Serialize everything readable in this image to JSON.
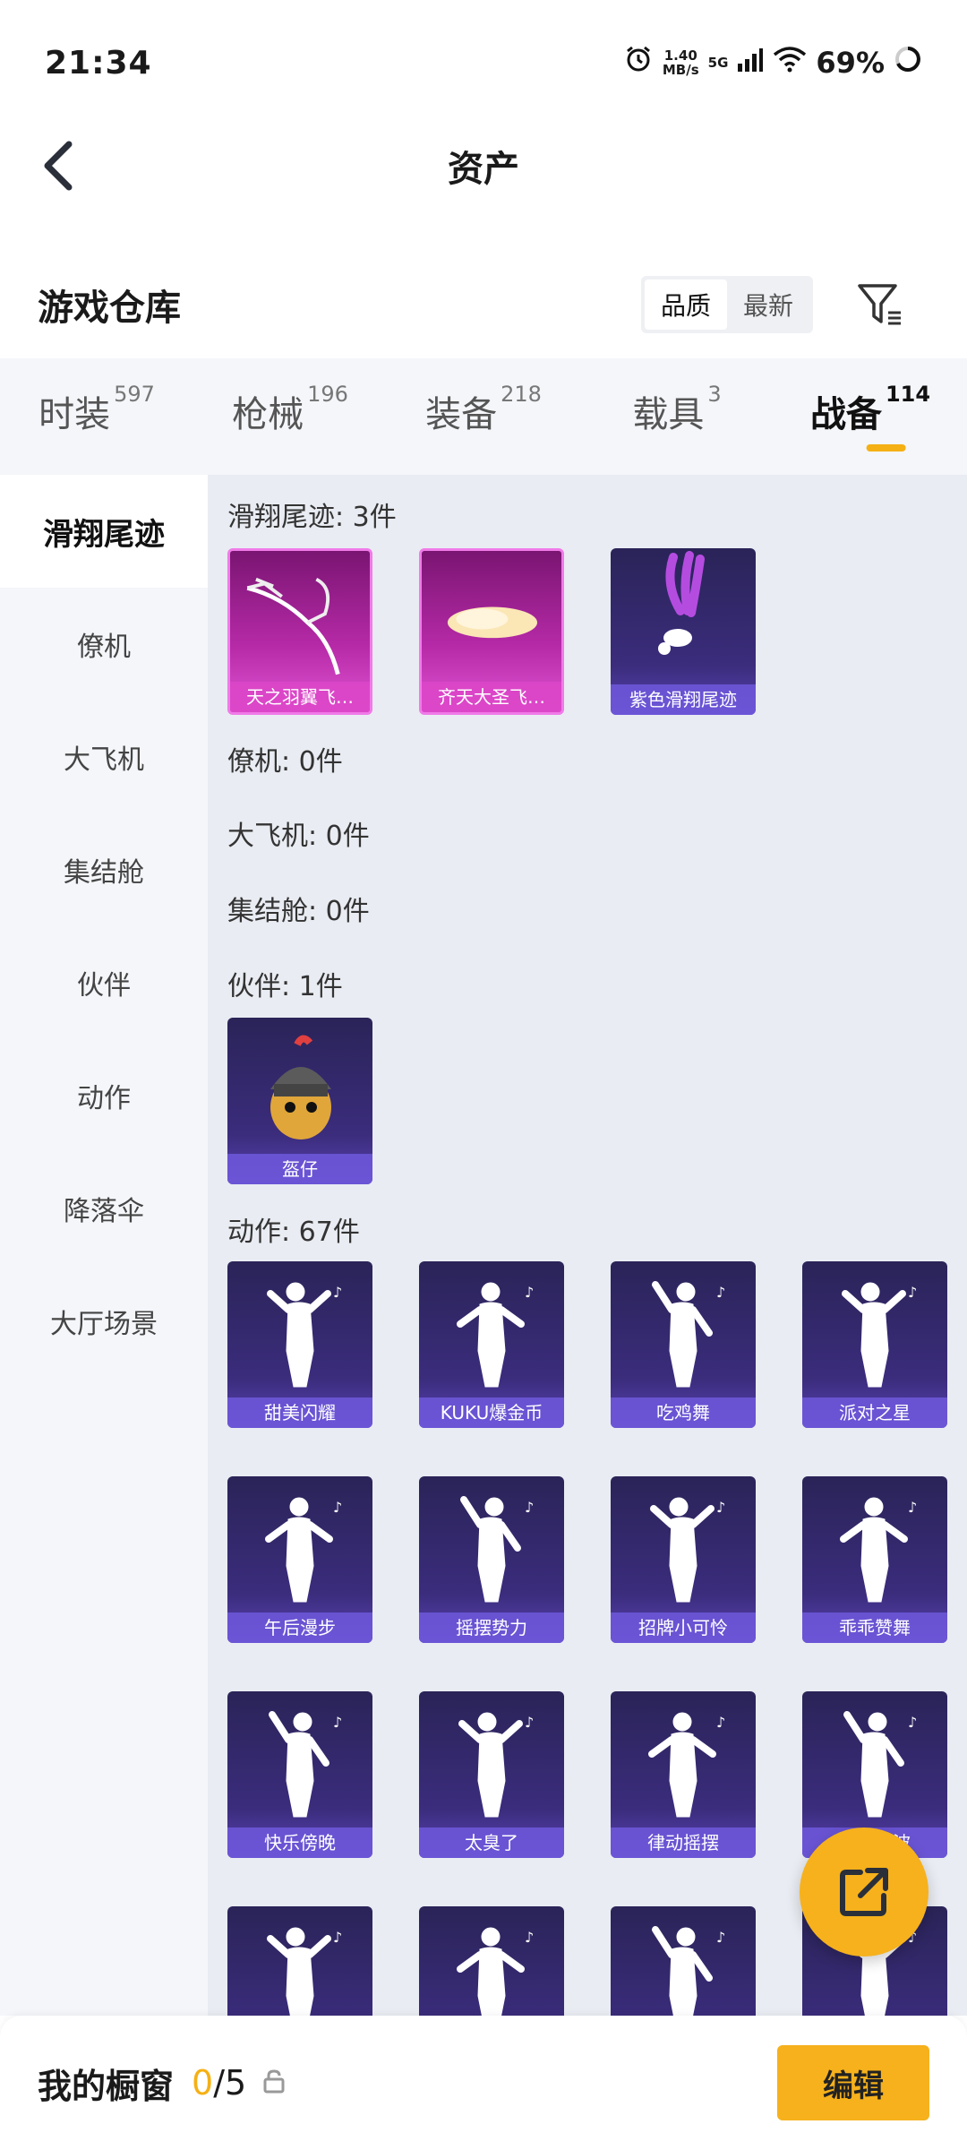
{
  "status_bar": {
    "time": "21:34",
    "speed_value": "1.40",
    "speed_unit": "MB/s",
    "network": "5G",
    "battery": "69%"
  },
  "header": {
    "title": "资产"
  },
  "warehouse": {
    "title": "游戏仓库",
    "sort_quality": "品质",
    "sort_newest": "最新"
  },
  "tabs": [
    {
      "label": "时装",
      "count": "597"
    },
    {
      "label": "枪械",
      "count": "196"
    },
    {
      "label": "装备",
      "count": "218"
    },
    {
      "label": "载具",
      "count": "3"
    },
    {
      "label": "战备",
      "count": "114"
    }
  ],
  "side_menu": [
    "滑翔尾迹",
    "僚机",
    "大飞机",
    "集结舱",
    "伙伴",
    "动作",
    "降落伞",
    "大厅场景"
  ],
  "sections": {
    "glide": {
      "title": "滑翔尾迹: 3件",
      "items": [
        "天之羽翼飞…",
        "齐天大圣飞…",
        "紫色滑翔尾迹"
      ]
    },
    "wingman": {
      "title": "僚机: 0件"
    },
    "plane": {
      "title": "大飞机: 0件"
    },
    "pod": {
      "title": "集结舱: 0件"
    },
    "partner": {
      "title": "伙伴: 1件",
      "items": [
        "盔仔"
      ]
    },
    "emote": {
      "title": "动作: 67件",
      "items": [
        "甜美闪耀",
        "KUKU爆金币",
        "吃鸡舞",
        "派对之星",
        "午后漫步",
        "摇摆势力",
        "招牌小可怜",
        "乖乖赞舞",
        "快乐傍晚",
        "太臭了",
        "律动摇摆",
        "动感光波",
        "",
        "",
        "",
        ""
      ]
    }
  },
  "bottom_bar": {
    "label": "我的橱窗",
    "filled": "0",
    "total": "/5",
    "edit": "编辑"
  },
  "colors": {
    "accent": "#f6b11c",
    "card_purple": "#3b2c7c",
    "card_pink": "#b72aa8"
  }
}
